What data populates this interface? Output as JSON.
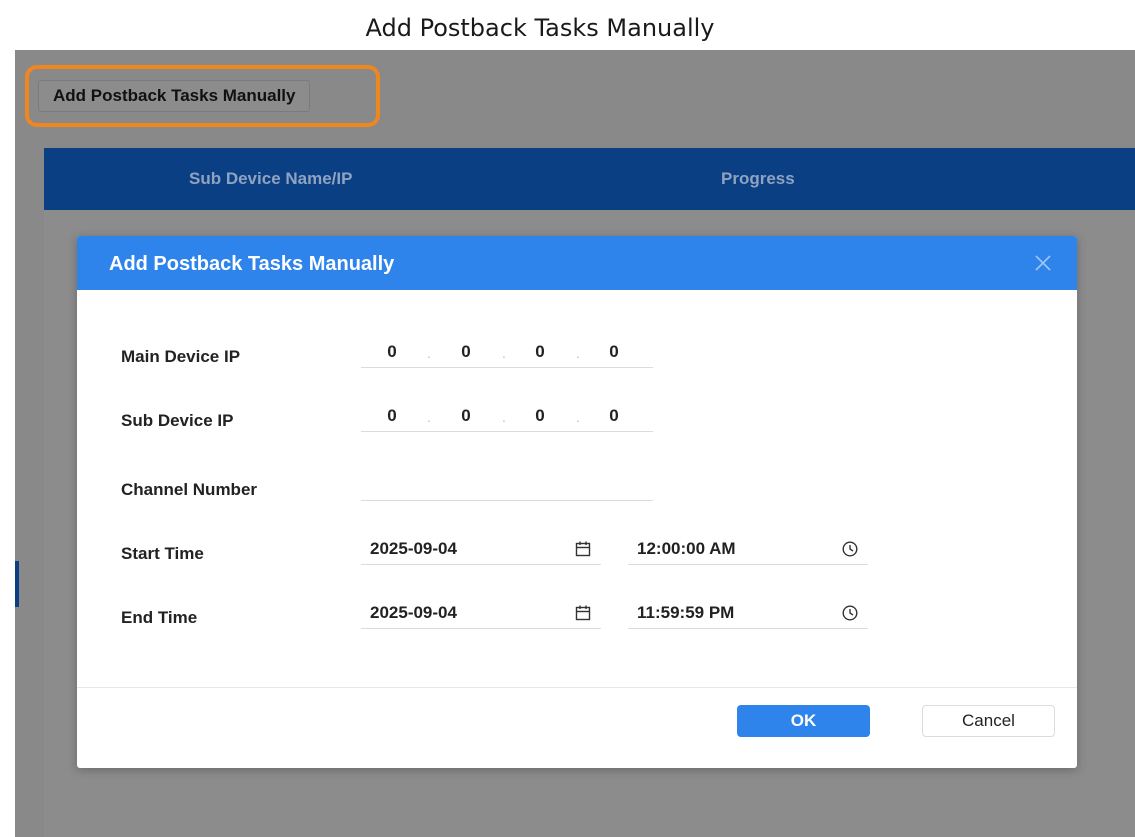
{
  "caption": "Add Postback Tasks Manually",
  "toolbar": {
    "add_button_label": "Add Postback Tasks Manually"
  },
  "table": {
    "columns": [
      "Sub Device Name/IP",
      "Progress"
    ]
  },
  "modal": {
    "title": "Add Postback Tasks Manually",
    "fields": {
      "main_device_ip": {
        "label": "Main Device IP",
        "segments": [
          "0",
          "0",
          "0",
          "0"
        ]
      },
      "sub_device_ip": {
        "label": "Sub Device IP",
        "segments": [
          "0",
          "0",
          "0",
          "0"
        ]
      },
      "channel_number": {
        "label": "Channel Number",
        "value": ""
      },
      "start_time": {
        "label": "Start Time",
        "date": "2025-09-04",
        "time": "12:00:00 AM"
      },
      "end_time": {
        "label": "End Time",
        "date": "2025-09-04",
        "time": "11:59:59 PM"
      }
    },
    "buttons": {
      "ok": "OK",
      "cancel": "Cancel"
    },
    "ip_separator": "."
  },
  "icons": {
    "close": "close-icon",
    "calendar": "calendar-icon",
    "clock": "clock-icon"
  },
  "colors": {
    "header_blue": "#2f84ec",
    "table_header": "#0b3f83",
    "highlight": "#f0861f"
  }
}
